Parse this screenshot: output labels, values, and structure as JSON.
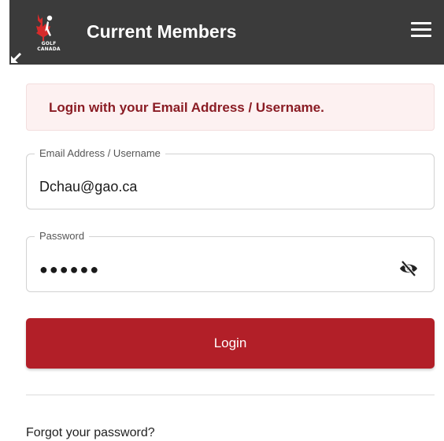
{
  "header": {
    "logo_text_line1": "GOLF",
    "logo_text_line2": "CANADA",
    "title": "Current Members",
    "menu_icon": "hamburger-menu-icon",
    "collapse_icon": "arrow-down-left-icon",
    "background_color": "#3b3b3b"
  },
  "alert": {
    "message": "Login with your Email Address / Username.",
    "text_color": "#8a1c24",
    "background_color": "#fdf1f1"
  },
  "form": {
    "email": {
      "label": "Email Address / Username",
      "value": "Dchau@gao.ca"
    },
    "password": {
      "label": "Password",
      "masked_value": "●●●●●●",
      "visibility_icon": "eye-slash-icon"
    },
    "login_label": "Login",
    "login_color": "#b21f28"
  },
  "links": {
    "forgot_password": "Forgot your password?"
  }
}
